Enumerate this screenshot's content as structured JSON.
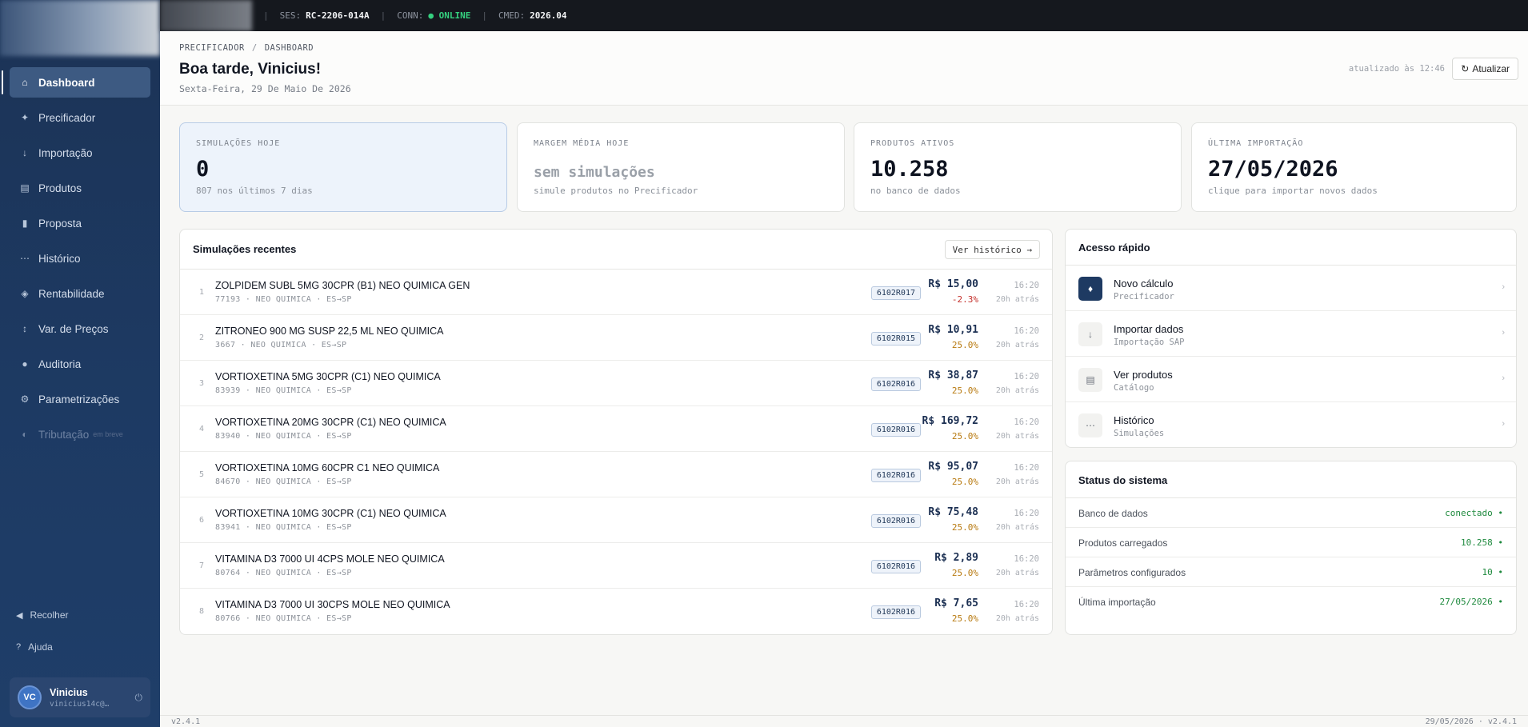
{
  "sidebar": {
    "items": [
      {
        "icon": "⌂",
        "icon_name": "home-icon",
        "label": "Dashboard",
        "active": true
      },
      {
        "icon": "✦",
        "icon_name": "sparkle-icon",
        "label": "Precificador"
      },
      {
        "icon": "↓",
        "icon_name": "download-icon",
        "label": "Importação"
      },
      {
        "icon": "▤",
        "icon_name": "list-icon",
        "label": "Produtos"
      },
      {
        "icon": "▮",
        "icon_name": "document-icon",
        "label": "Proposta"
      },
      {
        "icon": "⋯",
        "icon_name": "more-icon",
        "label": "Histórico"
      },
      {
        "icon": "◈",
        "icon_name": "diamond-icon",
        "label": "Rentabilidade"
      },
      {
        "icon": "↕",
        "icon_name": "up-down-arrows-icon",
        "label": "Var. de Preços"
      },
      {
        "icon": "●",
        "icon_name": "search-icon",
        "label": "Auditoria"
      },
      {
        "icon": "⚙",
        "icon_name": "gear-icon",
        "label": "Parametrizações"
      },
      {
        "icon": "◐",
        "icon_name": "half-circle-icon",
        "label": "Tributação",
        "badge": "em breve",
        "disabled": true
      }
    ],
    "collapse_label": "Recolher",
    "help_label": "Ajuda",
    "user": {
      "initials": "VC",
      "name": "Vinicius",
      "email": "vinicius14c@…"
    }
  },
  "topbar": {
    "ses_label": "SES:",
    "ses_value": "RC-2206-014A",
    "conn_label": "CONN:",
    "conn_value": "● ONLINE",
    "cmed_label": "CMED:",
    "cmed_value": "2026.04"
  },
  "header": {
    "breadcrumb_root": "PRECIFICADOR",
    "breadcrumb_sep": "/",
    "breadcrumb_current": "DASHBOARD",
    "greeting": "Boa tarde, Vinicius!",
    "date": "Sexta-Feira, 29 De Maio De 2026",
    "updated": "atualizado às 12:46",
    "refresh_label": "Atualizar"
  },
  "stats": [
    {
      "label": "SIMULAÇÕES HOJE",
      "value": "0",
      "sub": "807 nos últimos 7 dias"
    },
    {
      "label": "MARGEM MÉDIA HOJE",
      "value": "sem simulações",
      "sub": "simule produtos no Precificador"
    },
    {
      "label": "PRODUTOS ATIVOS",
      "value": "10.258",
      "sub": "no banco de dados"
    },
    {
      "label": "ÚLTIMA IMPORTAÇÃO",
      "value": "27/05/2026",
      "sub": "clique para importar novos dados"
    }
  ],
  "simulations": {
    "title": "Simulações recentes",
    "history_button": "Ver histórico →",
    "rows": [
      {
        "idx": "1",
        "name": "ZOLPIDEM SUBL 5MG 30CPR (B1) NEO QUIMICA GEN",
        "meta": "77193 · NEO QUIMICA · ES→SP",
        "code": "6102R017",
        "price": "R$ 15,00",
        "margin": "-2.3%",
        "time": "16:20",
        "ago": "20h atrás"
      },
      {
        "idx": "2",
        "name": "ZITRONEO 900 MG SUSP 22,5 ML NEO QUIMICA",
        "meta": "3667 · NEO QUIMICA · ES→SP",
        "code": "6102R015",
        "price": "R$ 10,91",
        "margin": "25.0%",
        "time": "16:20",
        "ago": "20h atrás"
      },
      {
        "idx": "3",
        "name": "VORTIOXETINA 5MG 30CPR (C1) NEO QUIMICA",
        "meta": "83939 · NEO QUIMICA · ES→SP",
        "code": "6102R016",
        "price": "R$ 38,87",
        "margin": "25.0%",
        "time": "16:20",
        "ago": "20h atrás"
      },
      {
        "idx": "4",
        "name": "VORTIOXETINA 20MG 30CPR (C1) NEO QUIMICA",
        "meta": "83940 · NEO QUIMICA · ES→SP",
        "code": "6102R016",
        "price": "R$ 169,72",
        "margin": "25.0%",
        "time": "16:20",
        "ago": "20h atrás"
      },
      {
        "idx": "5",
        "name": "VORTIOXETINA 10MG 60CPR C1 NEO QUIMICA",
        "meta": "84670 · NEO QUIMICA · ES→SP",
        "code": "6102R016",
        "price": "R$ 95,07",
        "margin": "25.0%",
        "time": "16:20",
        "ago": "20h atrás"
      },
      {
        "idx": "6",
        "name": "VORTIOXETINA 10MG 30CPR (C1) NEO QUIMICA",
        "meta": "83941 · NEO QUIMICA · ES→SP",
        "code": "6102R016",
        "price": "R$ 75,48",
        "margin": "25.0%",
        "time": "16:20",
        "ago": "20h atrás"
      },
      {
        "idx": "7",
        "name": "VITAMINA D3 7000 UI 4CPS MOLE NEO QUIMICA",
        "meta": "80764 · NEO QUIMICA · ES→SP",
        "code": "6102R016",
        "price": "R$ 2,89",
        "margin": "25.0%",
        "time": "16:20",
        "ago": "20h atrás"
      },
      {
        "idx": "8",
        "name": "VITAMINA D3 7000 UI 30CPS MOLE NEO QUIMICA",
        "meta": "80766 · NEO QUIMICA · ES→SP",
        "code": "6102R016",
        "price": "R$ 7,65",
        "margin": "25.0%",
        "time": "16:20",
        "ago": "20h atrás"
      }
    ]
  },
  "quick_access": {
    "title": "Acesso rápido",
    "items": [
      {
        "icon": "♦",
        "icon_name": "diamond-icon",
        "title": "Novo cálculo",
        "sub": "Precificador",
        "dark": true
      },
      {
        "icon": "↓",
        "icon_name": "download-icon",
        "title": "Importar dados",
        "sub": "Importação SAP"
      },
      {
        "icon": "▤",
        "icon_name": "list-icon",
        "title": "Ver produtos",
        "sub": "Catálogo"
      },
      {
        "icon": "⋯",
        "icon_name": "more-icon",
        "title": "Histórico",
        "sub": "Simulações"
      }
    ],
    "chevron": "›"
  },
  "system_status": {
    "title": "Status do sistema",
    "rows": [
      {
        "label": "Banco de dados",
        "value": "conectado •"
      },
      {
        "label": "Produtos carregados",
        "value": "10.258 •"
      },
      {
        "label": "Parâmetros configurados",
        "value": "10 •"
      },
      {
        "label": "Última importação",
        "value": "27/05/2026 •"
      }
    ]
  },
  "footer": {
    "left": "v2.4.1",
    "right": "29/05/2026 · v2.4.1"
  },
  "colors": {
    "sidebar_bg": "#1c3356",
    "accent": "#1e3a62",
    "online": "#35d07f",
    "margin_positive": "#b87a10",
    "margin_negative": "#c4302b",
    "status_ok": "#1f8a3e"
  }
}
